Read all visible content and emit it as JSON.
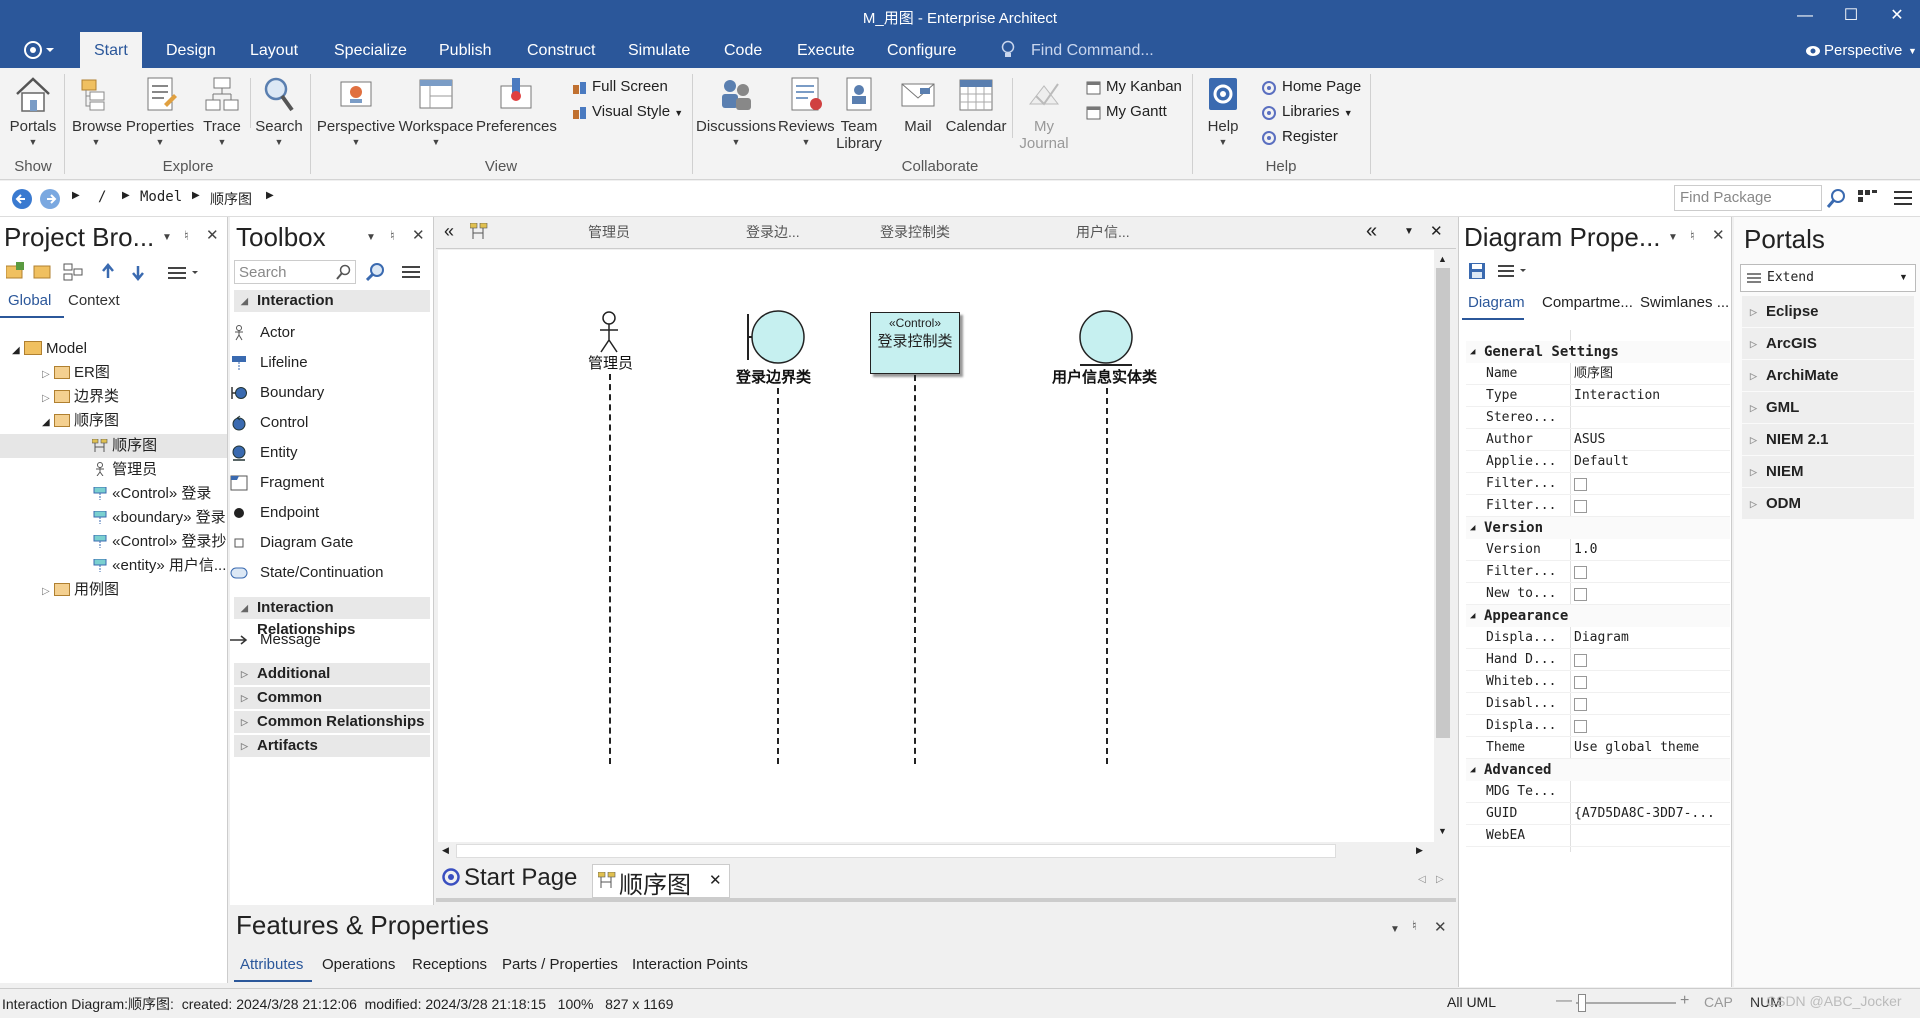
{
  "window": {
    "title": "M_用图 - Enterprise Architect"
  },
  "menu": {
    "tabs": [
      "Start",
      "Design",
      "Layout",
      "Specialize",
      "Publish",
      "Construct",
      "Simulate",
      "Code",
      "Execute",
      "Configure"
    ],
    "find_placeholder": "Find Command...",
    "perspective": "Perspective"
  },
  "ribbon": {
    "show": {
      "portals": "Portals",
      "group": "Show"
    },
    "explore": {
      "browse": "Browse",
      "properties": "Properties",
      "trace": "Trace",
      "search": "Search",
      "group": "Explore"
    },
    "view": {
      "perspective": "Perspective",
      "workspace": "Workspace",
      "preferences": "Preferences",
      "full_screen": "Full Screen",
      "visual_style": "Visual Style",
      "group": "View"
    },
    "collaborate": {
      "discussions": "Discussions",
      "reviews": "Reviews",
      "team": "Team",
      "library": "Library",
      "mail": "Mail",
      "calendar": "Calendar",
      "my": "My",
      "journal": "Journal",
      "my_kanban": "My Kanban",
      "my_gantt": "My Gantt",
      "group": "Collaborate"
    },
    "help": {
      "help": "Help",
      "home_page": "Home Page",
      "libraries": "Libraries",
      "register": "Register",
      "group": "Help"
    }
  },
  "address": {
    "root": "/",
    "model": "Model",
    "diagram": "顺序图",
    "find_package": "Find Package"
  },
  "project_browser": {
    "title": "Project Bro...",
    "tabs": [
      "Global",
      "Context"
    ],
    "tree": [
      "Model",
      "ER图",
      "边界类",
      "顺序图",
      "顺序图",
      "管理员",
      "«Control» 登录",
      "«boundary» 登录",
      "«Control» 登录抄",
      "«entity» 用户信...",
      "用例图"
    ]
  },
  "toolbox": {
    "title": "Toolbox",
    "search_placeholder": "Search",
    "interaction": {
      "label": "Interaction",
      "items": [
        "Actor",
        "Lifeline",
        "Boundary",
        "Control",
        "Entity",
        "Fragment",
        "Endpoint",
        "Diagram Gate",
        "State/Continuation"
      ]
    },
    "relationships": {
      "label": "Interaction Relationships",
      "items": [
        "Message"
      ]
    },
    "collapsed": [
      "Additional",
      "Common",
      "Common Relationships",
      "Artifacts"
    ]
  },
  "diagram": {
    "header_labels": [
      "管理员",
      "登录边...",
      "登录控制类",
      "用户信..."
    ],
    "actor": "管理员",
    "boundary": "登录边界类",
    "control_stereo": "«Control»",
    "control_name": "登录控制类",
    "entity": "用户信息实体类",
    "tabs": [
      "Start Page",
      "顺序图"
    ]
  },
  "diagram_properties": {
    "title": "Diagram Prope...",
    "tabs": [
      "Diagram",
      "Compartme...",
      "Swimlanes ..."
    ],
    "general": "General Settings",
    "name_k": "Name",
    "name_v": "顺序图",
    "type_k": "Type",
    "type_v": "Interaction",
    "stereo_k": "Stereo...",
    "author_k": "Author",
    "author_v": "ASUS",
    "applies_k": "Applie...",
    "applies_v": "Default",
    "filter1_k": "Filter...",
    "filter2_k": "Filter...",
    "version": "Version",
    "version_k": "Version",
    "version_v": "1.0",
    "filter3_k": "Filter...",
    "newto_k": "New to...",
    "appearance": "Appearance",
    "displa_k": "Displa...",
    "displa_v": "Diagram",
    "handd_k": "Hand D...",
    "whiteb_k": "Whiteb...",
    "disabl_k": "Disabl...",
    "displa2_k": "Displa...",
    "theme_k": "Theme",
    "theme_v": "Use global theme",
    "advanced": "Advanced",
    "mdg_k": "MDG Te...",
    "guid_k": "GUID",
    "guid_v": "{A7D5DA8C-3DD7-...",
    "webea_k": "WebEA"
  },
  "portals": {
    "title": "Portals",
    "selector": "Extend",
    "items": [
      "Eclipse",
      "ArcGIS",
      "ArchiMate",
      "GML",
      "NIEM 2.1",
      "NIEM",
      "ODM"
    ]
  },
  "features": {
    "title": "Features & Properties",
    "tabs": [
      "Attributes",
      "Operations",
      "Receptions",
      "Parts / Properties",
      "Interaction Points"
    ]
  },
  "status": {
    "left": "Interaction Diagram:顺序图:  created: 2024/3/28 21:12:06  modified: 2024/3/28 21:18:15   100%   827 x 1169",
    "all_uml": "All UML",
    "cap": "CAP",
    "num": "NUM",
    "watermark": "CSDN @ABC_Jocker"
  }
}
